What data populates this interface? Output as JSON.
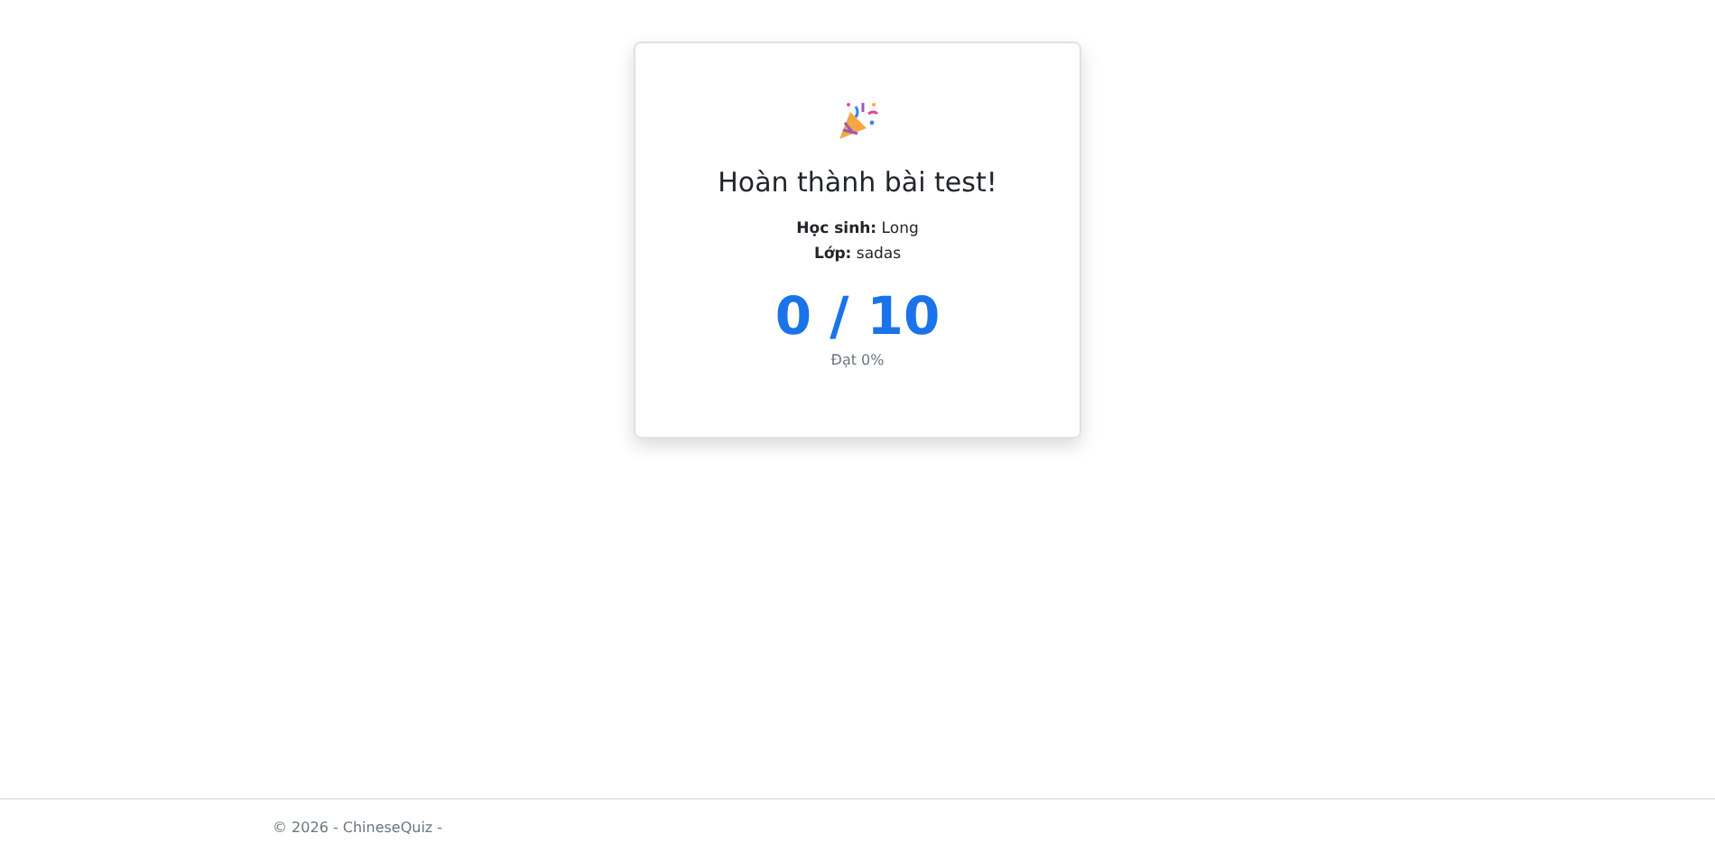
{
  "result_card": {
    "title": "Hoàn thành bài test!",
    "info": [
      "**Học sinh:** Long",
      "**Lớp:** sadas"
    ],
    "score": "0 / 10",
    "percent": "Đạt 0%"
  },
  "footer": {
    "text": "© 2026 - ChineseQuiz -"
  }
}
